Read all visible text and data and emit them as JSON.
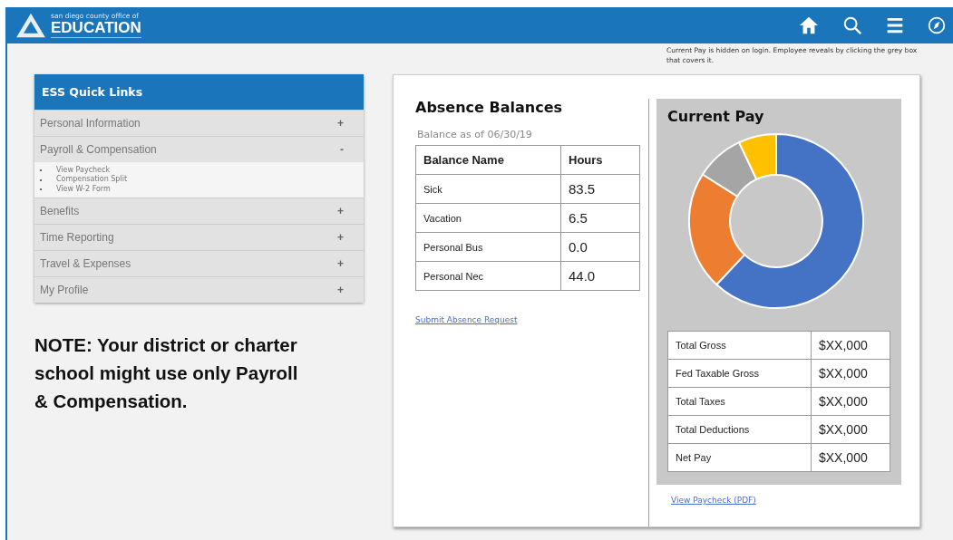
{
  "header": {
    "logo_small": "san diego county office of",
    "logo_title": "EDUCATION"
  },
  "annotation": "Current Pay is hidden on login. Employee reveals by clicking the grey box that covers it.",
  "quick_links": {
    "title": "ESS Quick Links",
    "items": [
      {
        "label": "Personal Information",
        "sign": "+"
      },
      {
        "label": "Payroll & Compensation",
        "sign": "-",
        "children": [
          {
            "label": "View Paycheck"
          },
          {
            "label": "Compensation Split"
          },
          {
            "label": "View W-2 Form"
          }
        ]
      },
      {
        "label": "Benefits",
        "sign": "+"
      },
      {
        "label": "Time Reporting",
        "sign": "+"
      },
      {
        "label": "Travel & Expenses",
        "sign": "+"
      },
      {
        "label": "My Profile",
        "sign": "+"
      }
    ]
  },
  "note": "NOTE: Your district or charter school might use only Payroll & Compensation.",
  "absence": {
    "title": "Absence Balances",
    "as_of": "Balance as of 06/30/19",
    "columns": [
      "Balance Name",
      "Hours"
    ],
    "rows": [
      [
        "Sick",
        "83.5"
      ],
      [
        "Vacation",
        "6.5"
      ],
      [
        "Personal Bus",
        "0.0"
      ],
      [
        "Personal Nec",
        "44.0"
      ]
    ],
    "link": "Submit Absence Request"
  },
  "current_pay": {
    "title": "Current Pay",
    "rows": [
      [
        "Total Gross",
        "$XX,000"
      ],
      [
        "Fed Taxable Gross",
        "$XX,000"
      ],
      [
        "Total Taxes",
        "$XX,000"
      ],
      [
        "Total Deductions",
        "$XX,000"
      ],
      [
        "Net Pay",
        "$XX,000"
      ]
    ],
    "link": "View Paycheck (PDF)"
  }
}
